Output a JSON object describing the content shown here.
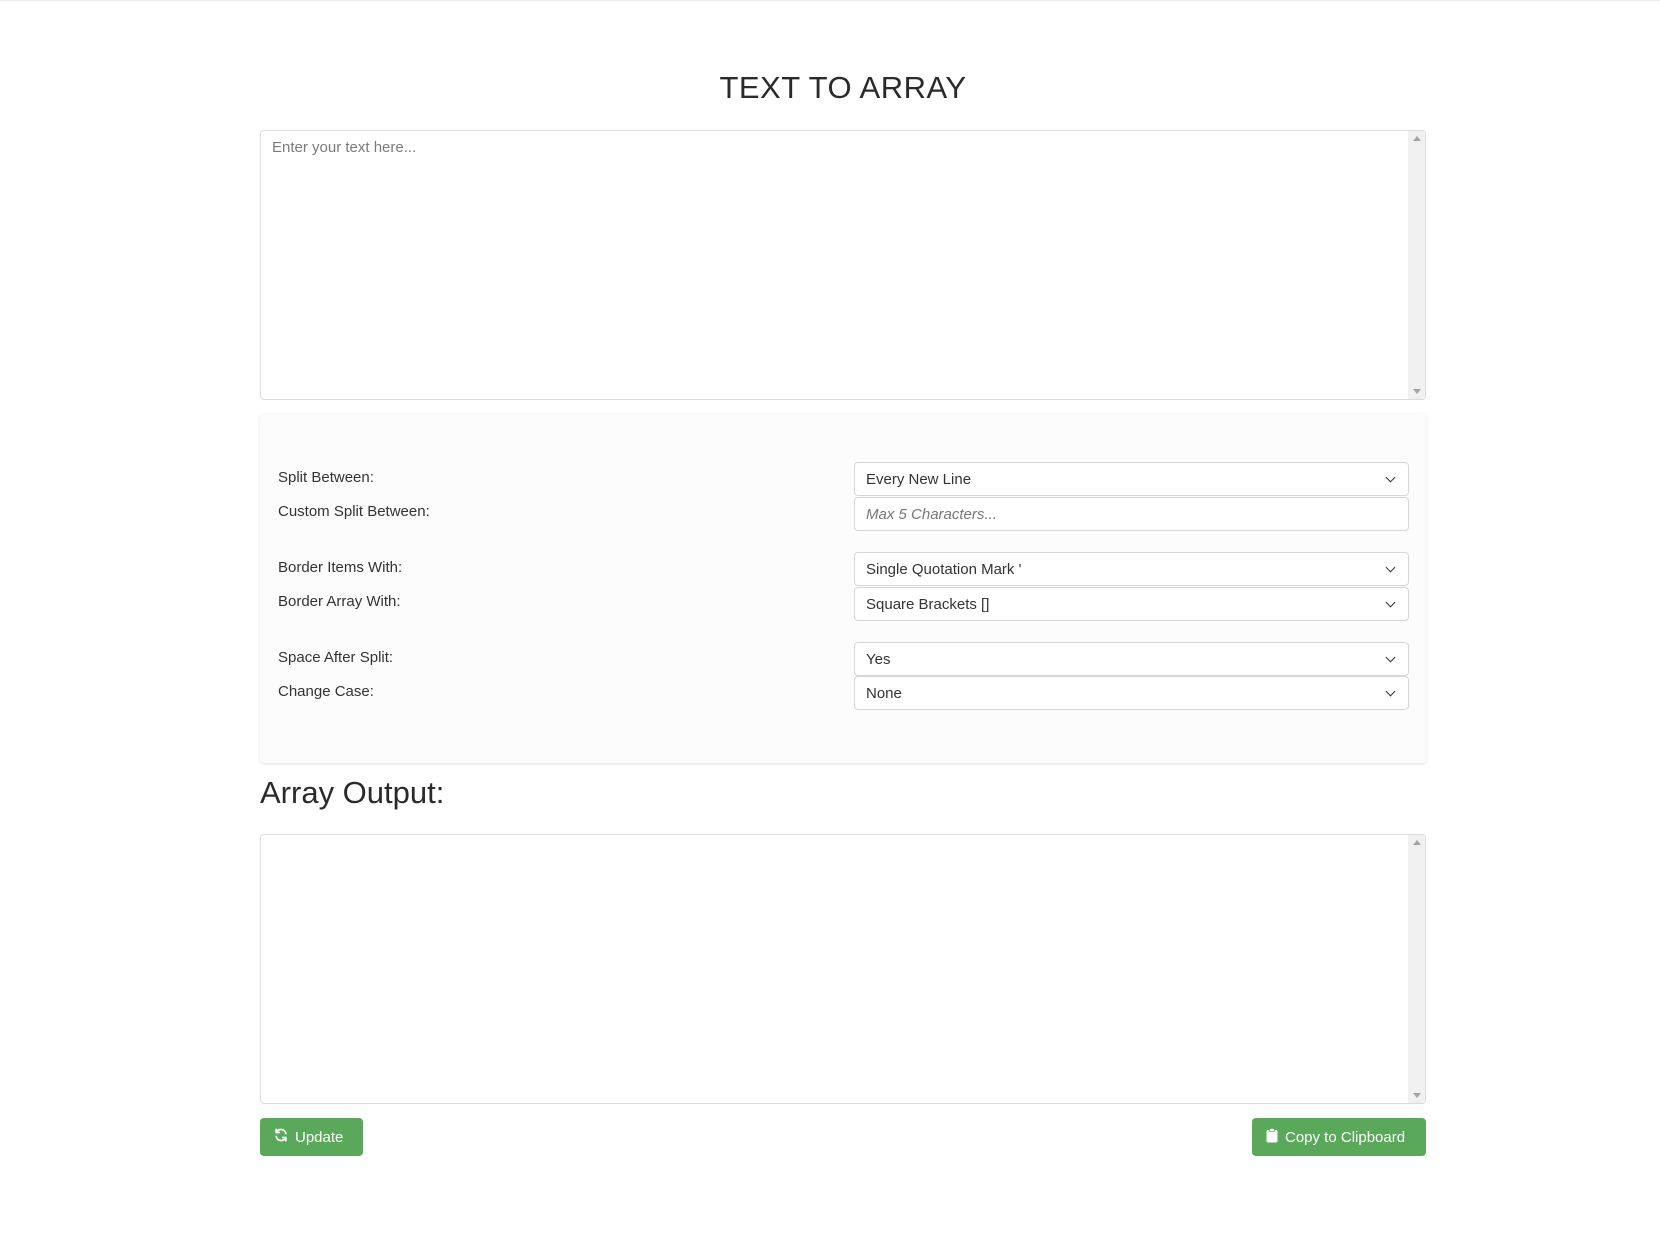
{
  "page": {
    "title": "TEXT TO ARRAY"
  },
  "input": {
    "placeholder": "Enter your text here...",
    "value": ""
  },
  "options": {
    "split_between": {
      "label": "Split Between:",
      "value": "Every New Line"
    },
    "custom_split": {
      "label": "Custom Split Between:",
      "placeholder": "Max 5 Characters..."
    },
    "border_items": {
      "label": "Border Items With:",
      "value": "Single Quotation Mark '"
    },
    "border_array": {
      "label": "Border Array With:",
      "value": "Square Brackets []"
    },
    "space_after_split": {
      "label": "Space After Split:",
      "value": "Yes"
    },
    "change_case": {
      "label": "Change Case:",
      "value": "None"
    }
  },
  "output": {
    "heading": "Array Output:",
    "value": ""
  },
  "buttons": {
    "update_label": "Update",
    "update_icon": "refresh-icon",
    "copy_label": "Copy to Clipboard",
    "copy_icon": "clipboard-icon"
  },
  "colors": {
    "accent": "#5aa85a",
    "panel_bg": "#fcfcfc",
    "border": "#dcdcdc"
  }
}
